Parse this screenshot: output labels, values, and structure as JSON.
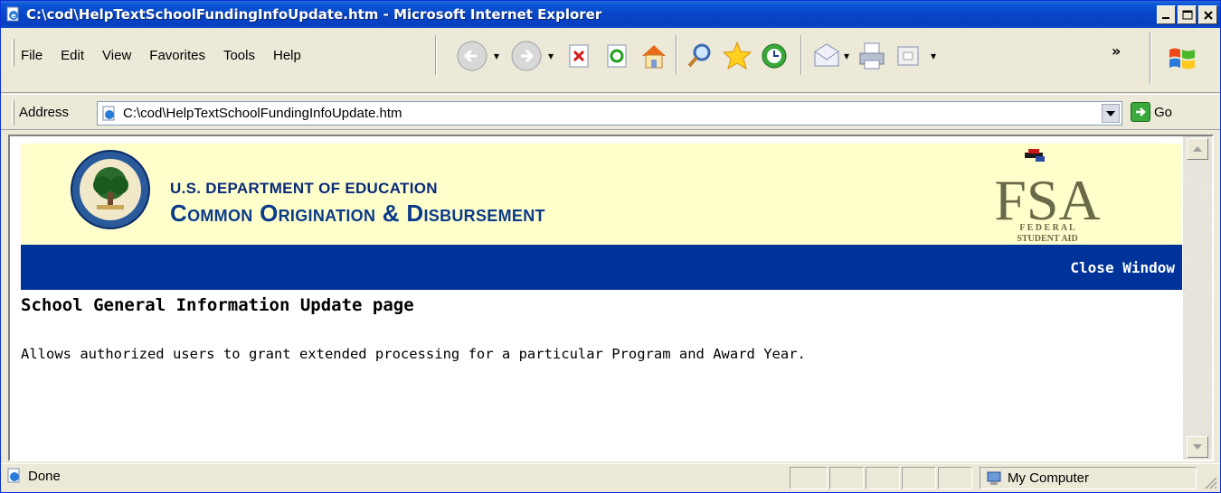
{
  "window": {
    "title": "C:\\cod\\HelpTextSchoolFundingInfoUpdate.htm - Microsoft Internet Explorer",
    "minimize": "minimize",
    "maximize": "maximize",
    "close": "close"
  },
  "menu": {
    "items": [
      {
        "label": "File",
        "key": "F"
      },
      {
        "label": "Edit",
        "key": "E"
      },
      {
        "label": "View",
        "key": "V"
      },
      {
        "label": "Favorites",
        "key": "a"
      },
      {
        "label": "Tools",
        "key": "T"
      },
      {
        "label": "Help",
        "key": "H"
      }
    ],
    "overflow": "»"
  },
  "toolbar": {
    "icons": [
      "back-icon",
      "forward-icon",
      "stop-icon",
      "refresh-icon",
      "home-icon",
      "search-icon",
      "favorites-icon",
      "history-icon",
      "mail-icon",
      "print-icon",
      "edit-icon"
    ]
  },
  "address": {
    "label": "Address",
    "value": "C:\\cod\\HelpTextSchoolFundingInfoUpdate.htm",
    "go": "Go"
  },
  "page": {
    "dept": "U.S. DEPARTMENT OF EDUCATION",
    "app_name": "Common Origination & Disbursement",
    "fsa_big": "FSA",
    "fsa_federal": "F E D E R A L",
    "fsa_student_aid": "STUDENT AID",
    "close_window": "Close Window",
    "title": "School General Information Update page",
    "description": "Allows authorized users to grant extended processing for a particular Program and Award Year."
  },
  "status": {
    "text": "Done",
    "zone": "My Computer"
  },
  "colors": {
    "titlebar": "#0745c8",
    "banner_bg": "#ffffcc",
    "bluebar": "#003399",
    "brand_text": "#0a3a8a"
  }
}
